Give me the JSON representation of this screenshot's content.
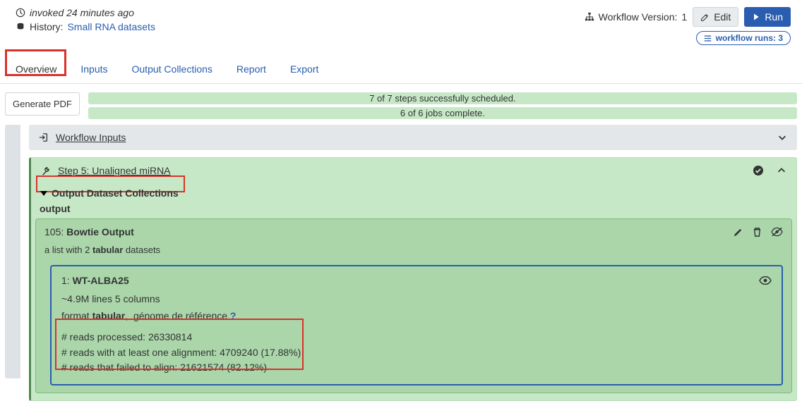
{
  "header": {
    "invoked_label": "invoked 24 minutes ago",
    "history_prefix": "History:",
    "history_link": "Small RNA datasets",
    "version_prefix": "Workflow Version:",
    "version_number": "1",
    "edit_label": "Edit",
    "run_label": "Run",
    "runs_badge": "workflow runs: 3"
  },
  "tabs": {
    "items": [
      "Overview",
      "Inputs",
      "Output Collections",
      "Report",
      "Export"
    ],
    "active_index": 0
  },
  "buttons": {
    "generate_pdf": "Generate PDF"
  },
  "status": {
    "steps": "7 of 7 steps successfully scheduled.",
    "jobs": "6 of 6 jobs complete."
  },
  "workflow_inputs_panel": {
    "title": "Workflow Inputs"
  },
  "step_panel": {
    "title": "Step 5: Unaligned miRNA",
    "output_collections_label": "Output Dataset Collections",
    "output_key": "output"
  },
  "collection": {
    "prefix": "105:",
    "name": "Bowtie Output",
    "sub_prefix": "a list with 2",
    "sub_format": "tabular",
    "sub_suffix": "datasets"
  },
  "dataset": {
    "index": "1:",
    "name": "WT-ALBA25",
    "lines_cols": "~4.9M lines 5 columns",
    "format_prefix": "format",
    "format_value": "tabular",
    "format_sep": ",",
    "genome_label": "génome de référence",
    "genome_help": "?",
    "reads": [
      "# reads processed: 26330814",
      "# reads with at least one alignment: 4709240 (17.88%)",
      "# reads that failed to align: 21621574 (82.12%)"
    ]
  },
  "icons": {
    "clock": "clock",
    "database": "database",
    "sitemap": "sitemap",
    "edit": "pencil-square",
    "play": "play",
    "list": "list",
    "chevron_down": "chevron-down",
    "chevron_up": "chevron-up",
    "login": "sign-in",
    "wrench": "wrench",
    "check": "check-circle",
    "pencil": "pencil",
    "trash": "trash",
    "eye_slash": "eye-slash",
    "eye": "eye"
  }
}
